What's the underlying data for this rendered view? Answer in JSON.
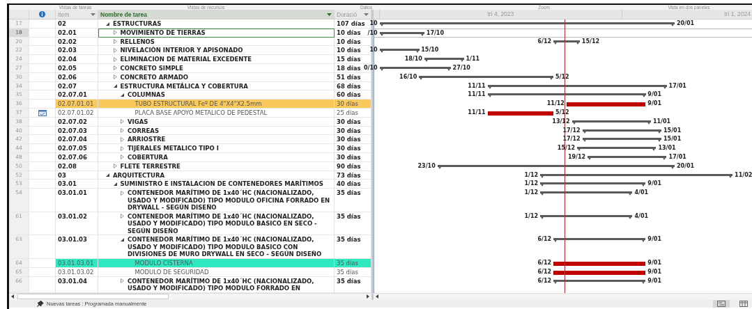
{
  "ribbon_groups": [
    "Vistas de tareas",
    "Vistas de recursos",
    "Datos",
    "Zoom",
    "Vista en dos paneles"
  ],
  "table": {
    "columns": [
      {
        "kind": "indicator",
        "selected": false
      },
      {
        "kind": "text",
        "label": "Item",
        "selected": false
      },
      {
        "kind": "text",
        "label": "Nombre de tarea",
        "selected": true
      },
      {
        "kind": "text",
        "label": "Duració",
        "selected": false
      }
    ],
    "rows": [
      {
        "num": "17",
        "item": "02",
        "name": "ESTRUCTURAS",
        "duration": "107 días",
        "summary": true,
        "expanded": true,
        "selected": false,
        "indicator": false,
        "bar": {
          "kind": "summary",
          "start_label": "10",
          "finish_label": "20/01"
        },
        "children": [
          {
            "num": "18",
            "item": "02.01",
            "name": "MOVIMIENTO DE TIERRAS",
            "duration": "10 días",
            "summary": true,
            "expanded": false,
            "selected": true,
            "indicator": false,
            "bar": {
              "kind": "summary",
              "start_label": "/10",
              "finish_label": "17/10"
            }
          },
          {
            "num": "20",
            "item": "02.02",
            "name": "RELLENOS",
            "duration": "10 días",
            "summary": true,
            "expanded": false,
            "selected": false,
            "indicator": false,
            "bar": {
              "kind": "summary",
              "start_label": "6/12",
              "finish_label": "15/12"
            }
          },
          {
            "num": "22",
            "item": "02.03",
            "name": "NIVELACIÓN INTERIOR Y APISONADO",
            "duration": "10 días",
            "summary": true,
            "expanded": false,
            "selected": false,
            "indicator": false,
            "bar": {
              "kind": "summary",
              "start_label": "10",
              "finish_label": "15/10"
            }
          },
          {
            "num": "24",
            "item": "02.04",
            "name": "ELIMINACION DE MATERIAL EXCEDENTE",
            "duration": "15 días",
            "summary": true,
            "expanded": false,
            "selected": false,
            "indicator": false,
            "bar": {
              "kind": "summary",
              "start_label": "18/10",
              "finish_label": "1/11"
            }
          },
          {
            "num": "27",
            "item": "02.05",
            "name": "CONCRETO SIMPLE",
            "duration": "18 días",
            "summary": true,
            "expanded": false,
            "selected": false,
            "indicator": false,
            "bar": {
              "kind": "summary",
              "start_label": "0/10",
              "finish_label": "27/10"
            }
          },
          {
            "num": "30",
            "item": "02.06",
            "name": "CONCRETO ARMADO",
            "duration": "51 días",
            "summary": true,
            "expanded": false,
            "selected": false,
            "indicator": false,
            "bar": {
              "kind": "summary",
              "start_label": "16/10",
              "finish_label": "5/12"
            }
          },
          {
            "num": "34",
            "item": "02.07",
            "name": "ESTRUCTURA METÁLICA Y COBERTURA",
            "duration": "68 días",
            "summary": true,
            "expanded": true,
            "selected": false,
            "indicator": false,
            "bar": {
              "kind": "summary",
              "start_label": "11/11",
              "finish_label": "17/01"
            },
            "children": [
              {
                "num": "35",
                "item": "02.07.01",
                "name": "COLUMNAS",
                "duration": "60 días",
                "summary": true,
                "expanded": true,
                "selected": false,
                "indicator": false,
                "bar": {
                  "kind": "summary",
                  "start_label": "11/11",
                  "finish_label": "9/01"
                },
                "children": [
                  {
                    "num": "36",
                    "item": "02.07.01.01",
                    "name": "TUBO ESTRUCTURAL Feº DE 4\"X4\"X2.5mm",
                    "duration": "30 días",
                    "summary": false,
                    "selected": false,
                    "indicator": false,
                    "color": "#f9c95c",
                    "bar": {
                      "kind": "critical",
                      "start_label": "11/12",
                      "finish_label": "9/01"
                    }
                  },
                  {
                    "num": "37",
                    "item": "02.07.01.02",
                    "name": "PLACA BASE APOYO METALICO DE PEDESTAL",
                    "duration": "25 días",
                    "summary": false,
                    "selected": false,
                    "indicator": true,
                    "bar": {
                      "kind": "critical",
                      "start_label": "11/11",
                      "finish_label": "5/12"
                    }
                  }
                ]
              },
              {
                "num": "38",
                "item": "02.07.02",
                "name": "VIGAS",
                "duration": "30 días",
                "summary": true,
                "expanded": false,
                "selected": false,
                "indicator": false,
                "bar": {
                  "kind": "summary",
                  "start_label": "13/12",
                  "finish_label": "11/01"
                }
              },
              {
                "num": "40",
                "item": "02.07.03",
                "name": "CORREAS",
                "duration": "30 días",
                "summary": true,
                "expanded": false,
                "selected": false,
                "indicator": false,
                "bar": {
                  "kind": "summary",
                  "start_label": "17/12",
                  "finish_label": "15/01"
                }
              },
              {
                "num": "42",
                "item": "02.07.04",
                "name": "ARRIOSTRE",
                "duration": "30 días",
                "summary": true,
                "expanded": false,
                "selected": false,
                "indicator": false,
                "bar": {
                  "kind": "summary",
                  "start_label": "17/12",
                  "finish_label": "15/01"
                }
              },
              {
                "num": "44",
                "item": "02.07.05",
                "name": "TIJERALES METALICO TIPO I",
                "duration": "30 días",
                "summary": true,
                "expanded": false,
                "selected": false,
                "indicator": false,
                "bar": {
                  "kind": "summary",
                  "start_label": "15/12",
                  "finish_label": "13/01"
                }
              },
              {
                "num": "48",
                "item": "02.07.06",
                "name": "COBERTURA",
                "duration": "30 días",
                "summary": true,
                "expanded": false,
                "selected": false,
                "indicator": false,
                "bar": {
                  "kind": "summary",
                  "start_label": "19/12",
                  "finish_label": "17/01"
                }
              }
            ]
          },
          {
            "num": "50",
            "item": "02.08",
            "name": "FLETE TERRESTRE",
            "duration": "90 días",
            "summary": true,
            "expanded": false,
            "selected": false,
            "indicator": false,
            "bar": {
              "kind": "summary",
              "start_label": "23/10",
              "finish_label": "20/01"
            }
          }
        ]
      },
      {
        "num": "52",
        "item": "03",
        "name": "ARQUITECTURA",
        "duration": "73 días",
        "summary": true,
        "expanded": true,
        "selected": false,
        "indicator": false,
        "bar": {
          "kind": "summary",
          "start_label": "1/12",
          "finish_label": "11/02"
        },
        "children": [
          {
            "num": "53",
            "item": "03.01",
            "name": "SUMINISTRO E INSTALACION DE CONTENEDORES MARÍTIMOS",
            "duration": "40 días",
            "summary": true,
            "expanded": true,
            "selected": false,
            "indicator": false,
            "bar": {
              "kind": "summary",
              "start_label": "1/12",
              "finish_label": "9/01"
            },
            "children": [
              {
                "num": "54",
                "item": "03.01.01",
                "name": "CONTENEDOR MARÍTIMO DE 1x40´HC (NACIONALIZADO, USADO Y MODIFICADO) TIPO MODULO OFICINA FORRADO EN DRYWALL - SEGÚN DISEÑO",
                "duration": "35 días",
                "summary": true,
                "expanded": false,
                "selected": false,
                "indicator": false,
                "bar": {
                  "kind": "summary",
                  "start_label": "1/12",
                  "finish_label": "4/01"
                }
              },
              {
                "num": "61",
                "item": "03.01.02",
                "name": "CONTENEDOR MARÍTIMO DE 1x40´HC (NACIONALIZADO, USADO Y MODIFICADO) TIPO MODULO BASICO EN SECO - SEGÚN DISEÑO",
                "duration": "35 días",
                "summary": true,
                "expanded": false,
                "selected": false,
                "indicator": false,
                "bar": {
                  "kind": "summary",
                  "start_label": "1/12",
                  "finish_label": "4/01"
                }
              },
              {
                "num": "63",
                "item": "03.01.03",
                "name": "CONTENEDOR MARÍTIMO DE 1x40´HC (NACIONALIZADO, USADO Y MODIFICADO) TIPO MODULO BASICO CON DIVISIONES DE MURO DRYWALL EN SECO - SEGÚN DISEÑO",
                "duration": "35 días",
                "summary": true,
                "expanded": true,
                "selected": false,
                "indicator": false,
                "bar": {
                  "kind": "summary",
                  "start_label": "6/12",
                  "finish_label": "9/01"
                },
                "children": [
                  {
                    "num": "64",
                    "item": "03.01.03.01",
                    "name": "MODULO CISTERNA",
                    "duration": "35 días",
                    "summary": false,
                    "selected": false,
                    "indicator": false,
                    "color": "#2ee8c0",
                    "bar": {
                      "kind": "critical",
                      "start_label": "6/12",
                      "finish_label": "9/01"
                    }
                  },
                  {
                    "num": "65",
                    "item": "03.01.03.02",
                    "name": "MODULO DE SEGURIDAD",
                    "duration": "35 días",
                    "summary": false,
                    "selected": false,
                    "indicator": false,
                    "bar": {
                      "kind": "critical",
                      "start_label": "6/12",
                      "finish_label": "9/01"
                    }
                  }
                ]
              },
              {
                "num": "66",
                "item": "03.01.04",
                "name": "CONTENEDOR MARÍTIMO DE 1x40´HC (NACIONALIZADO, USADO Y MODIFICADO) TIPO MODULO FORRADO EN",
                "duration": "35 días",
                "summary": true,
                "expanded": false,
                "selected": false,
                "indicator": false,
                "bar": {
                  "kind": "summary",
                  "start_label": "6/12",
                  "finish_label": "9/01"
                }
              }
            ]
          }
        ]
      }
    ]
  },
  "gantt": {
    "timescale": [
      {
        "label": "tri 4, 2023"
      },
      {
        "label": "tri 1, 2024"
      }
    ]
  },
  "status_bar": {
    "text": "Nuevas tareas : Programada manualmente"
  }
}
